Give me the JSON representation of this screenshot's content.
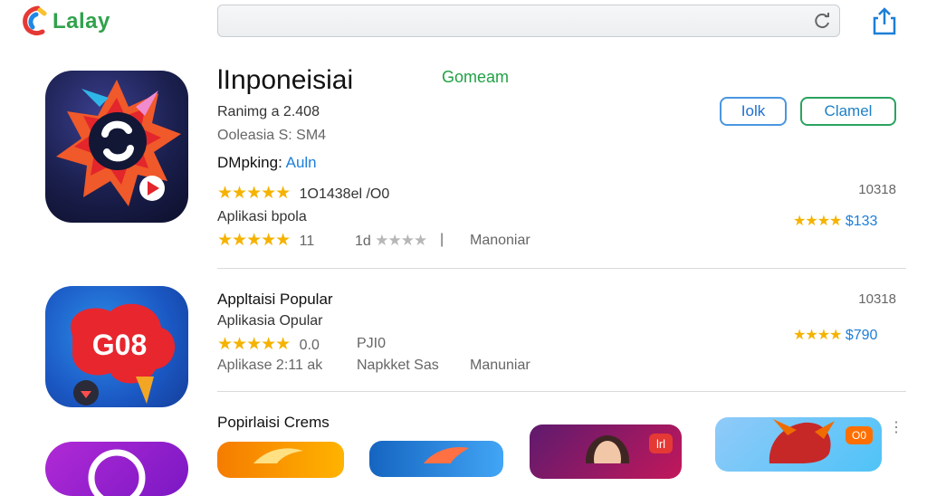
{
  "header": {
    "logo_text": "Lalay",
    "search_value": ""
  },
  "featured": {
    "title": "lInponeisiai",
    "category_link": "Gomeam",
    "ranking": "Ranimg a 2.408",
    "developer": "Ooleasia S: SM4",
    "dmoking_label": "DMpking:",
    "dmoking_value": "Auln",
    "rating_text": "1O1438el /O0",
    "subtitle": "Aplikasi bpola",
    "meta_count": "11",
    "meta_score": "1d",
    "meta_sep": "|",
    "meta_tag": "Manoniar",
    "btn_small": "Iolk",
    "btn_primary": "Clamel",
    "right_num": "10318",
    "right_price": "$133"
  },
  "second": {
    "title": "Appltaisi Popular",
    "subtitle": "Aplikasia Opular",
    "rating_text": "0.0",
    "meta_a": "PJI0",
    "line3_a": "Aplikase 2:11 ak",
    "line3_b": "Napkket Sas",
    "line3_c": "Manuniar",
    "right_num": "10318",
    "right_price": "$790"
  },
  "popular_section": {
    "heading": "Popirlaisi Crems",
    "more_icon": "more-vertical-icon"
  },
  "icons": {
    "icon2_text": "G08",
    "thumb3_badge": "lrl",
    "thumb4_badge": "O0"
  },
  "colors": {
    "accent_green": "#21a145",
    "accent_blue": "#1c7fd8",
    "star": "#f5b301"
  }
}
